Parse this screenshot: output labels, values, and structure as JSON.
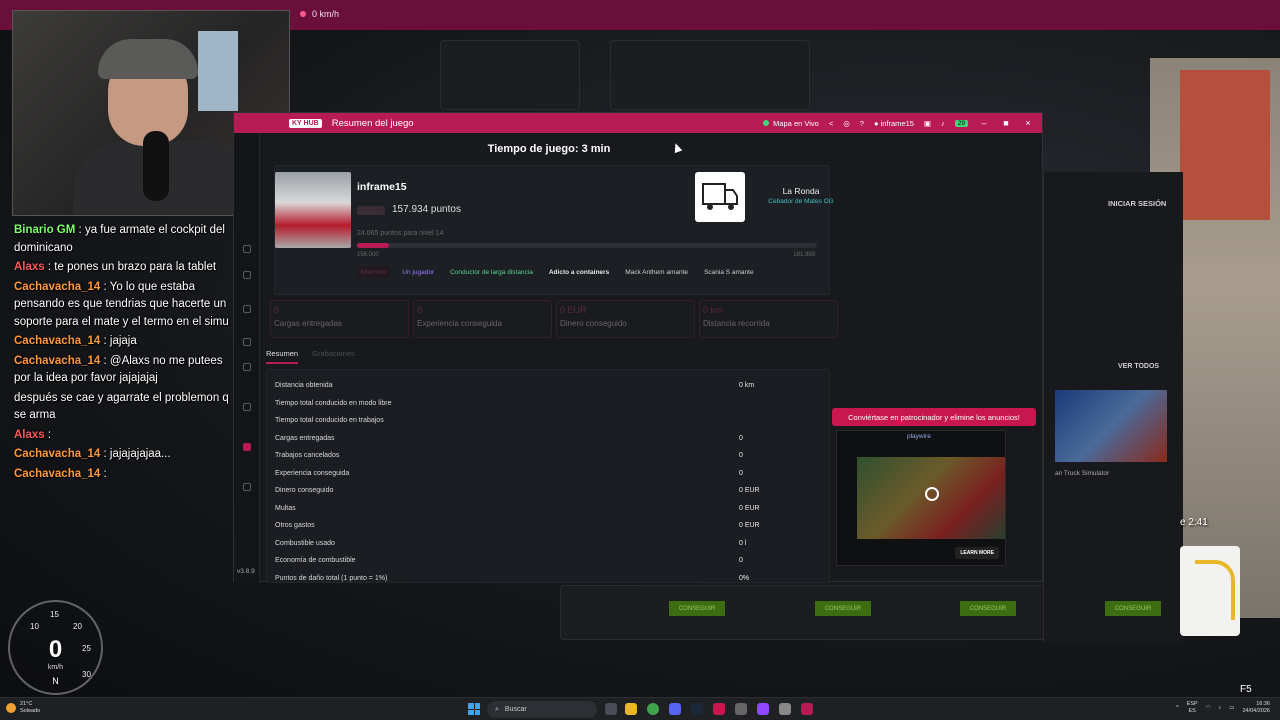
{
  "top_bar": {
    "speed": "0 km/h"
  },
  "chat": [
    {
      "user": "Binario GM",
      "user_color": "#7cff6a",
      "text": "ya fue armate el cockpit del dominicano"
    },
    {
      "user": "Alaxs",
      "user_color": "#ff5a5a",
      "text": "te pones un brazo para la tablet"
    },
    {
      "user": "Cachavacha_14",
      "user_color": "#ff9a3a",
      "text": "Yo lo que estaba pensando es que tendrias que hacerte un soporte para el mate y el termo en el simu"
    },
    {
      "user": "Cachavacha_14",
      "user_color": "#ff9a3a",
      "text": "jajaja"
    },
    {
      "user": "Cachavacha_14",
      "user_color": "#ff9a3a",
      "text": "@Alaxs no me putees por la idea por favor jajajajaj"
    },
    {
      "user": "",
      "user_color": "#9d7bff",
      "text": "después se cae y agarrate el problemon q se arma"
    },
    {
      "user": "Alaxs",
      "user_color": "#ff5a5a",
      "text": ""
    },
    {
      "user": "Cachavacha_14",
      "user_color": "#ff9a3a",
      "text": "jajajajajaa..."
    },
    {
      "user": "Cachavacha_14",
      "user_color": "#ff9a3a",
      "text": ""
    }
  ],
  "speedometer": {
    "value": "0",
    "unit": "km/h",
    "gear": "N",
    "ticks": [
      "10",
      "15",
      "20",
      "25",
      "30"
    ]
  },
  "hub": {
    "logo": "KY HUB",
    "title": "Resumen del juego",
    "live_map": "Mapa en Vivo",
    "username_top": "inframe15",
    "notif_count": "29",
    "version": "v3.8.9",
    "playtime": "Tiempo de juego: 3 min",
    "profile": {
      "username": "inframe15",
      "points": "157.934 puntos",
      "next_level": "24.065 puntos para nivel 14",
      "progress": 0.07,
      "prog_min": "156.000",
      "prog_max": "181.999",
      "tags": [
        {
          "label": "Miembro",
          "style": "dim"
        },
        {
          "label": "Un jugador",
          "style": "purple"
        },
        {
          "label": "Conductor de larga distancia",
          "style": "green"
        },
        {
          "label": "Adicto a containers",
          "style": "white"
        },
        {
          "label": "Mack Anthem amante",
          "style": "gray"
        },
        {
          "label": "Scania S amante",
          "style": "gray"
        }
      ]
    },
    "company": {
      "name": "La Ronda",
      "subtitle": "Cebador de Mates OG"
    },
    "stats": [
      {
        "value": "0",
        "label": "Cargas entregadas"
      },
      {
        "value": "0",
        "label": "Experiencia conseguida"
      },
      {
        "value": "0 EUR",
        "label": "Dinero conseguido"
      },
      {
        "value": "0 km",
        "label": "Distancia recorrida"
      }
    ],
    "tabs": [
      "Resumen",
      "Grabaciones"
    ],
    "summary": [
      {
        "label": "Distancia obtenida",
        "value": "0 km"
      },
      {
        "label": "Tiempo total conducido en modo libre",
        "value": ""
      },
      {
        "label": "Tiempo total conducido en trabajos",
        "value": ""
      },
      {
        "label": "Cargas entregadas",
        "value": "0"
      },
      {
        "label": "Trabajos cancelados",
        "value": "0"
      },
      {
        "label": "Experiencia conseguida",
        "value": "0"
      },
      {
        "label": "Dinero conseguido",
        "value": "0 EUR"
      },
      {
        "label": "Multas",
        "value": "0 EUR"
      },
      {
        "label": "Otros gastos",
        "value": "0 EUR"
      },
      {
        "label": "Combustible usado",
        "value": "0 l"
      },
      {
        "label": "Economía de combustible",
        "value": "0"
      },
      {
        "label": "Puntos de daño total (1 punto = 1%)",
        "value": "0%"
      }
    ]
  },
  "ad": {
    "banner": "Conviértase en patrocinador y elimine los anuncios!",
    "brand": "playwire",
    "cta": "LEARN MORE"
  },
  "launcher": {
    "login": "INICIAR SESIÓN",
    "see_all": "VER TODOS",
    "game_caption": "an Truck Simulator",
    "get_label": "CONSEGUIR"
  },
  "hud": {
    "clock": "e 2:41",
    "fps": "F5"
  },
  "taskbar": {
    "weather_temp": "21°C",
    "weather_desc": "Soleado",
    "search": "Buscar",
    "lang_top": "ESP",
    "lang_bottom": "ES",
    "time": "16:36",
    "date": "24/04/2026"
  },
  "colors": {
    "accent": "#b81a54",
    "live": "#3fd67a",
    "company_sub": "#3ec3c8"
  }
}
